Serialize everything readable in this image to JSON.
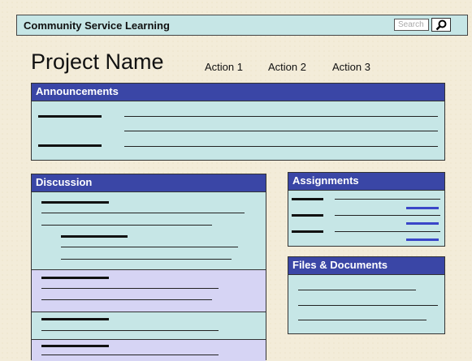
{
  "header": {
    "app_title": "Community Service Learning",
    "search_placeholder": "Search"
  },
  "project": {
    "name": "Project Name",
    "actions": [
      "Action 1",
      "Action 2",
      "Action 3"
    ]
  },
  "panels": {
    "announcements": "Announcements",
    "discussion": "Discussion",
    "assignments": "Assignments",
    "files": "Files & Documents"
  },
  "colors": {
    "header_blue": "#3a46a6",
    "panel_teal": "#c6e6e6",
    "thread_lavender": "#d6d4f4"
  }
}
